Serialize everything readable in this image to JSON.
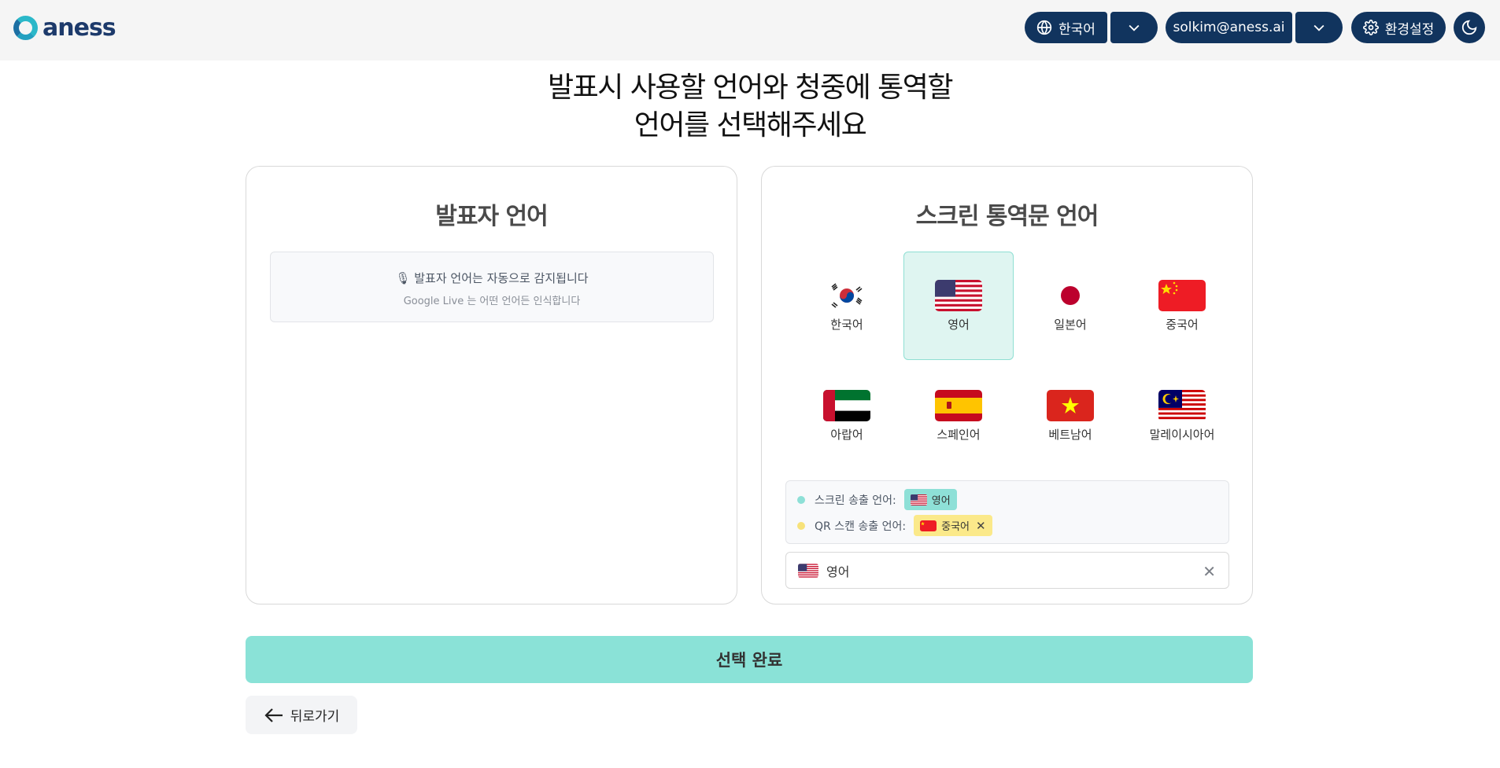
{
  "header": {
    "logo_text": "aness",
    "ui_language": "한국어",
    "user_email": "solkim@aness.ai",
    "settings_label": "환경설정"
  },
  "title": {
    "line1": "발표시 사용할 언어와 청중에 통역할",
    "line2": "언어를 선택해주세요"
  },
  "speaker_card": {
    "title": "발표자 언어",
    "autodetect_text": "🎙 발표자 언어는 자동으로 감지됩니다",
    "autodetect_sub": "Google Live 는 어떤 언어든 인식합니다"
  },
  "screen_card": {
    "title": "스크린 통역문 언어",
    "languages": [
      {
        "label": "한국어",
        "flag": "kr",
        "selected": false
      },
      {
        "label": "영어",
        "flag": "us",
        "selected": true
      },
      {
        "label": "일본어",
        "flag": "jp",
        "selected": false
      },
      {
        "label": "중국어",
        "flag": "cn",
        "selected": false
      },
      {
        "label": "아랍어",
        "flag": "ae",
        "selected": false
      },
      {
        "label": "스페인어",
        "flag": "es",
        "selected": false
      },
      {
        "label": "베트남어",
        "flag": "vn",
        "selected": false
      },
      {
        "label": "말레이시아어",
        "flag": "my",
        "selected": false
      }
    ],
    "summary": {
      "screen_label": "스크린 송출 언어:",
      "screen_value": "영어",
      "qr_label": "QR 스캔 송출 언어:",
      "qr_value": "중국어"
    },
    "select_value": "영어"
  },
  "confirm_label": "선택 완료",
  "back_label": "뒤로가기",
  "colors": {
    "header_bg": "#f5f5f5",
    "pill_bg": "#11345e",
    "accent": "#8ae2d7",
    "selected_tile": "#dff5f1",
    "qr_chip": "#fbe98a"
  }
}
